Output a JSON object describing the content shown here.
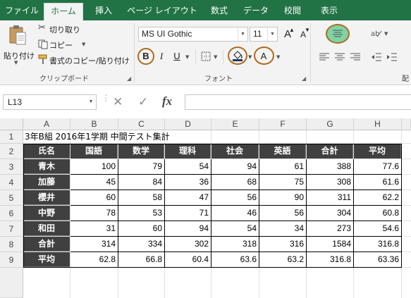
{
  "tabs": [
    "ファイル",
    "ホーム",
    "挿入",
    "ページ レイアウト",
    "数式",
    "データ",
    "校閲",
    "表示"
  ],
  "active_tab": "ホーム",
  "clipboard": {
    "paste_label": "貼り付け",
    "cut_label": "切り取り",
    "copy_label": "コピー",
    "format_painter_label": "書式のコピー/貼り付け",
    "group_label": "クリップボード"
  },
  "font": {
    "font_name": "MS UI Gothic",
    "font_size": "11",
    "bold_label": "B",
    "italic_label": "I",
    "underline_label": "U",
    "grow_label": "A",
    "shrink_label": "A",
    "font_color_label": "A",
    "group_label": "フォント"
  },
  "alignment": {
    "group_label_partial": "配"
  },
  "formula_bar": {
    "name_box": "L13",
    "cancel_icon": "✕",
    "enter_icon": "✓",
    "fx_label": "fx",
    "formula": ""
  },
  "grid": {
    "columns": [
      "A",
      "B",
      "C",
      "D",
      "E",
      "F",
      "G",
      "H"
    ],
    "rows": [
      "1",
      "2",
      "3",
      "4",
      "5",
      "6",
      "7",
      "8",
      "9"
    ],
    "title": "3年B組 2016年1学期 中間テスト集計",
    "headers": [
      "氏名",
      "国語",
      "数学",
      "理科",
      "社会",
      "英語",
      "合計",
      "平均"
    ],
    "data": [
      [
        "青木",
        "100",
        "79",
        "54",
        "94",
        "61",
        "388",
        "77.6"
      ],
      [
        "加藤",
        "45",
        "84",
        "36",
        "68",
        "75",
        "308",
        "61.6"
      ],
      [
        "櫻井",
        "60",
        "58",
        "47",
        "56",
        "90",
        "311",
        "62.2"
      ],
      [
        "中野",
        "78",
        "53",
        "71",
        "46",
        "56",
        "304",
        "60.8"
      ],
      [
        "和田",
        "31",
        "60",
        "94",
        "54",
        "34",
        "273",
        "54.6"
      ],
      [
        "合計",
        "314",
        "334",
        "302",
        "318",
        "316",
        "1584",
        "316.8"
      ],
      [
        "平均",
        "62.8",
        "66.8",
        "60.4",
        "63.6",
        "63.2",
        "316.8",
        "63.36"
      ]
    ]
  },
  "colors": {
    "ribbon_green": "#217346",
    "header_dark": "#404040",
    "annotation_ring": "#b06a1a",
    "highlight_green": "#7fd3a5"
  }
}
